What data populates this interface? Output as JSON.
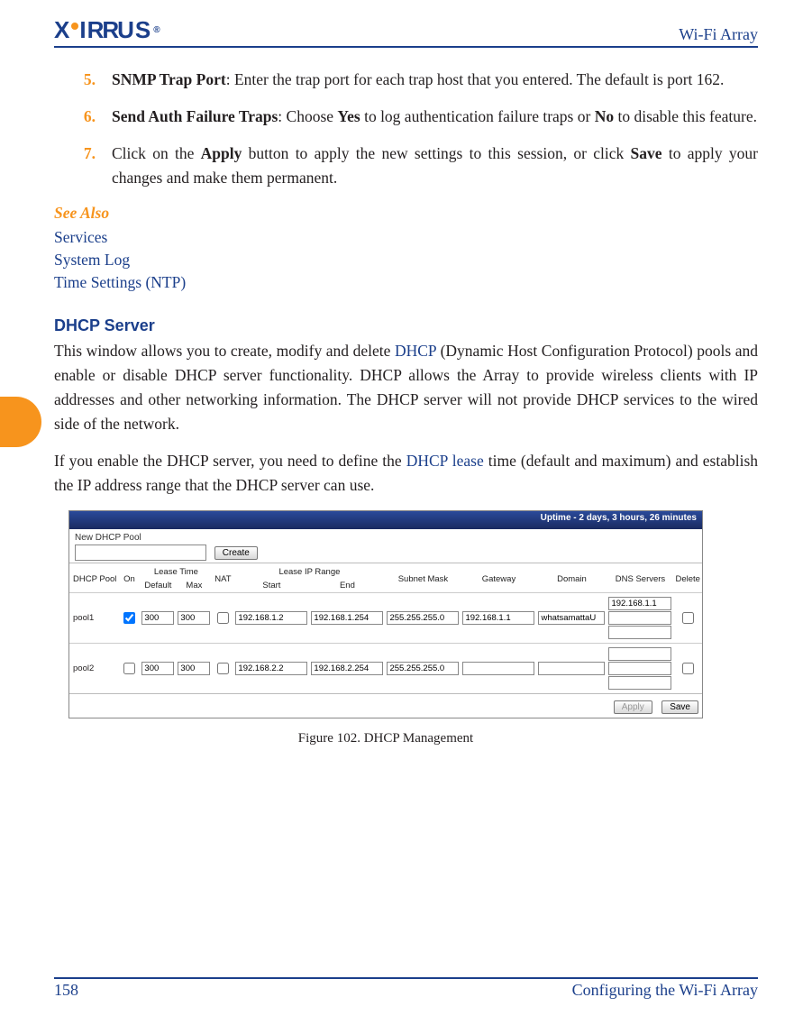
{
  "header": {
    "brand": "XIRRUS",
    "doc_title": "Wi-Fi Array"
  },
  "steps": [
    {
      "num": "5.",
      "bold": "SNMP Trap Port",
      "rest": ": Enter the trap port for each trap host that you entered. The default is port 162."
    },
    {
      "num": "6.",
      "bold": "Send Auth Failure Traps",
      "rest_1": ": Choose ",
      "yes": "Yes",
      "rest_2": " to log authentication failure traps or ",
      "no": "No",
      "rest_3": " to disable this feature."
    },
    {
      "num": "7.",
      "rest_1": "Click on the ",
      "apply": "Apply",
      "rest_2": " button to apply the new settings to this session, or click ",
      "save": "Save",
      "rest_3": " to apply your changes and make them permanent."
    }
  ],
  "see_also": {
    "heading": "See Also",
    "links": [
      "Services",
      "System Log",
      "Time Settings (NTP)"
    ]
  },
  "dhcp": {
    "heading": "DHCP Server",
    "p1_a": "This window allows you to create, modify and delete ",
    "p1_link1": "DHCP",
    "p1_b": " (Dynamic Host Configuration Protocol) pools and enable or disable DHCP server functionality. DHCP allows the Array to provide wireless clients with IP addresses and other networking information. The DHCP server will not provide DHCP services to the wired side of the network.",
    "p2_a": "If you enable the DHCP server, you need to define the ",
    "p2_link1": "DHCP lease",
    "p2_b": " time (default and maximum) and establish the IP address range that the DHCP server can use."
  },
  "figure": {
    "uptime": "Uptime - 2 days, 3 hours, 26 minutes",
    "new_pool_label": "New DHCP Pool",
    "create_btn": "Create",
    "group_lease": "Lease Time",
    "group_range": "Lease IP Range",
    "cols": {
      "pool": "DHCP Pool",
      "on": "On",
      "def": "Default",
      "max": "Max",
      "nat": "NAT",
      "start": "Start",
      "end": "End",
      "mask": "Subnet Mask",
      "gw": "Gateway",
      "dom": "Domain",
      "dns": "DNS Servers",
      "del": "Delete"
    },
    "rows": [
      {
        "name": "pool1",
        "on": true,
        "def": "300",
        "max": "300",
        "nat": false,
        "start": "192.168.1.2",
        "end": "192.168.1.254",
        "mask": "255.255.255.0",
        "gw": "192.168.1.1",
        "dom": "whatsamattaU",
        "dns1": "192.168.1.1",
        "dns2": "",
        "dns3": ""
      },
      {
        "name": "pool2",
        "on": false,
        "def": "300",
        "max": "300",
        "nat": false,
        "start": "192.168.2.2",
        "end": "192.168.2.254",
        "mask": "255.255.255.0",
        "gw": "",
        "dom": "",
        "dns1": "",
        "dns2": "",
        "dns3": ""
      }
    ],
    "apply_btn": "Apply",
    "save_btn": "Save",
    "caption": "Figure 102. DHCP Management"
  },
  "footer": {
    "page": "158",
    "section": "Configuring the Wi-Fi Array"
  }
}
